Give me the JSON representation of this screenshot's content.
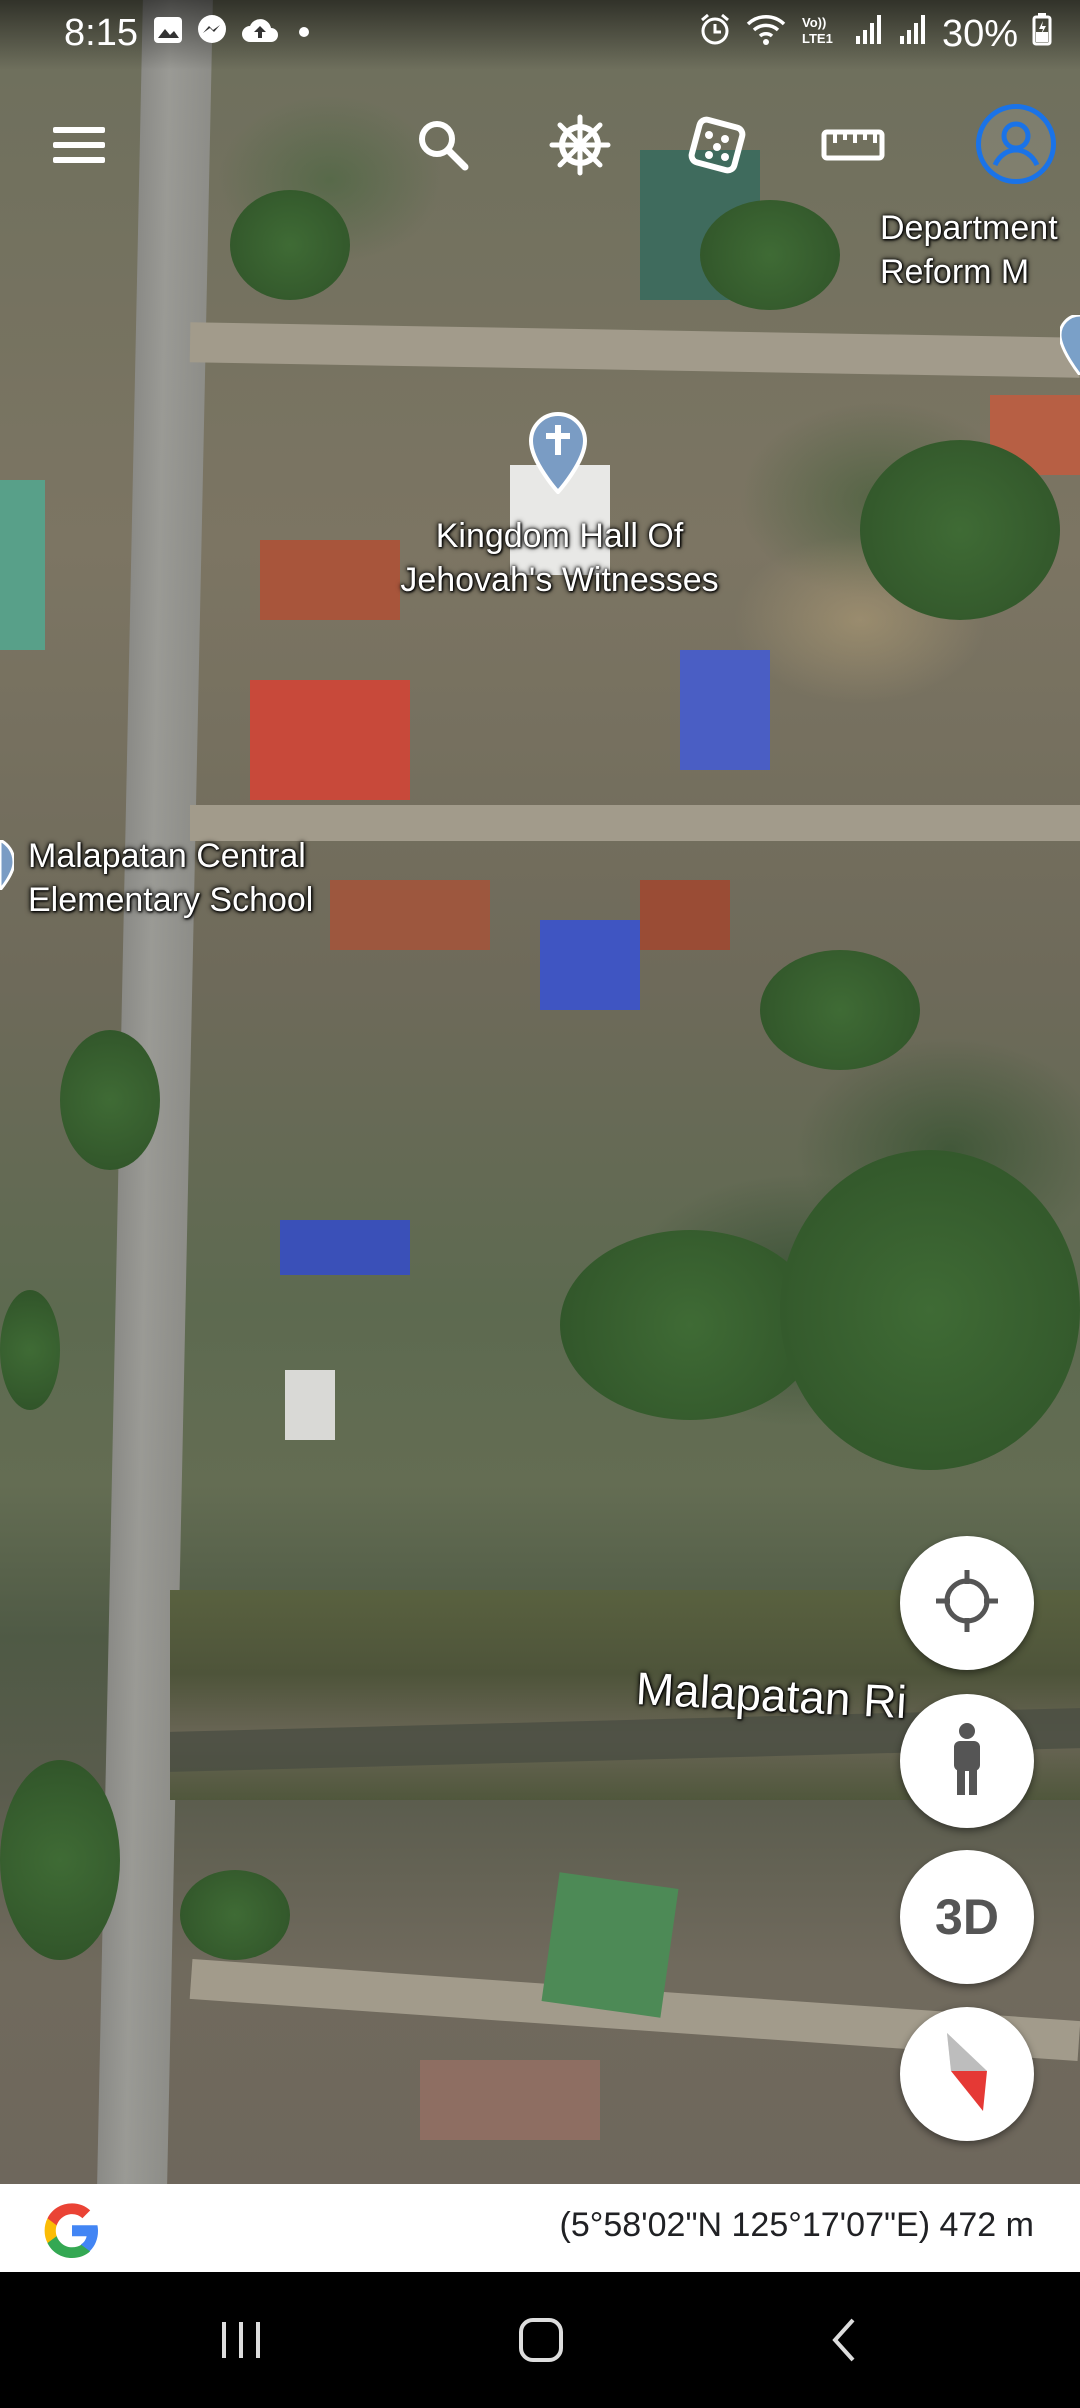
{
  "status_bar": {
    "time": "8:15",
    "battery": "30%",
    "left_icons": [
      "gallery-icon",
      "messenger-icon",
      "cloud-upload-icon",
      "dot-icon"
    ],
    "right_icons": [
      "alarm-icon",
      "wifi-icon",
      "volte-icon",
      "signal-icon",
      "signal-icon",
      "battery-icon"
    ]
  },
  "toolbar": {
    "menu_icon": "menu-icon",
    "search_icon": "search-icon",
    "voyager_icon": "ship-wheel-icon",
    "feeling_lucky_icon": "dice-icon",
    "measure_icon": "ruler-icon",
    "account_icon": "account-icon",
    "account_color": "#1a73e8"
  },
  "map": {
    "labels": {
      "department": "Department\nReform M",
      "kingdom_hall": "Kingdom Hall Of\nJehovah's Witnesses",
      "school": "Malapatan Central\nElementary School",
      "river": "Malapatan Ri"
    }
  },
  "controls": {
    "my_location_icon": "crosshair-icon",
    "street_view_icon": "pegman-icon",
    "three_d_label": "3D",
    "compass_icon": "compass-icon",
    "compass_color": "#e53935"
  },
  "info_bar": {
    "coordinates": "(5°58'02\"N 125°17'07\"E) 472 m",
    "logo": "google-g-logo"
  },
  "nav_bar": {
    "recents_icon": "recents-icon",
    "home_icon": "home-icon",
    "back_icon": "back-icon"
  }
}
